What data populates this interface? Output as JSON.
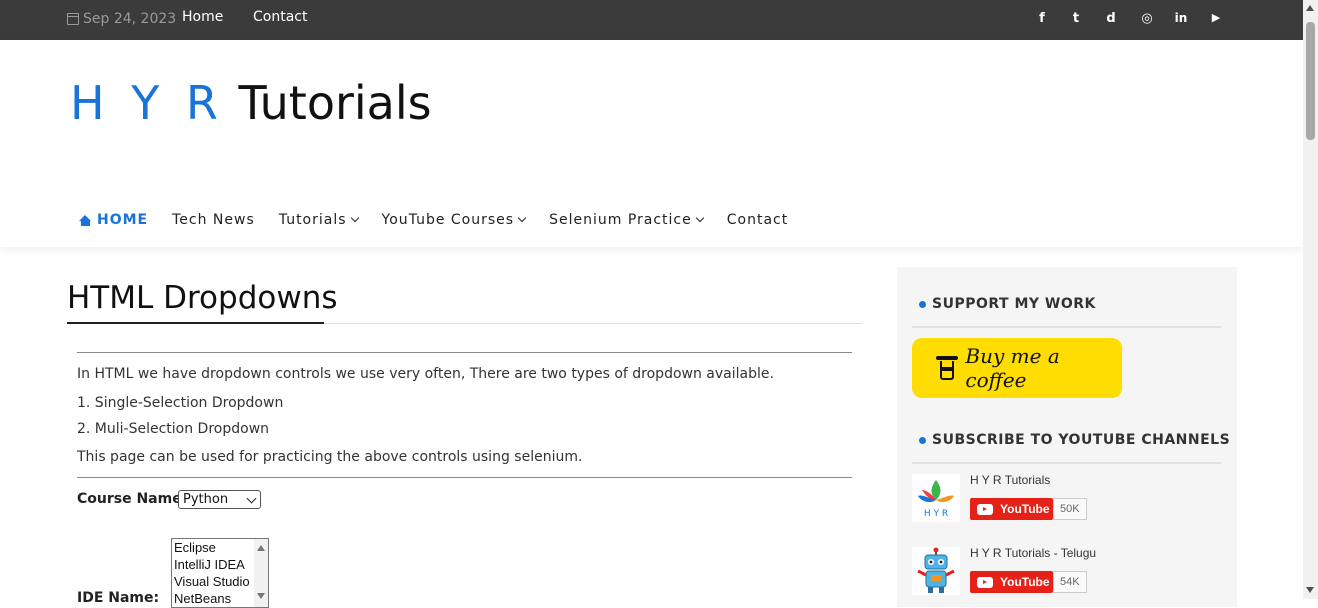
{
  "topbar": {
    "date": "Sep 24, 2023",
    "links": [
      "Home",
      "Contact"
    ],
    "social": [
      {
        "icon": "facebook-icon",
        "glyph": "f"
      },
      {
        "icon": "twitter-icon",
        "glyph": "t"
      },
      {
        "icon": "discord-icon",
        "glyph": "d"
      },
      {
        "icon": "instagram-icon",
        "glyph": "◎"
      },
      {
        "icon": "linkedin-icon",
        "glyph": "in"
      },
      {
        "icon": "youtube-icon",
        "glyph": "▶"
      }
    ]
  },
  "logo": {
    "part1": "H Y R",
    "part2": " Tutorials"
  },
  "nav": {
    "home": "HOME",
    "tech_news": "Tech News",
    "tutorials": "Tutorials",
    "youtube_courses": "YouTube Courses",
    "selenium_practice": "Selenium Practice",
    "contact": "Contact"
  },
  "main": {
    "title": "HTML Dropdowns",
    "intro": "In HTML we have dropdown controls we use very often, There are two types of dropdown available.",
    "item1": "1. Single-Selection Dropdown",
    "item2": "2. Muli-Selection Dropdown",
    "note": "This page can be used for practicing the above controls using selenium.",
    "course_label": "Course Name:",
    "course_value": "Python",
    "ide_label": "IDE Name:",
    "ide_options": [
      "Eclipse",
      "IntelliJ IDEA",
      "Visual Studio",
      "NetBeans"
    ]
  },
  "sidebar": {
    "support_heading": "SUPPORT MY WORK",
    "coffee_label": "Buy me a coffee",
    "subscribe_heading": "SUBSCRIBE TO YOUTUBE CHANNELS",
    "channels": [
      {
        "name": "H Y R Tutorials",
        "button": "YouTube",
        "count": "50K",
        "logo_text": "H Y R"
      },
      {
        "name": "H Y R Tutorials - Telugu",
        "button": "YouTube",
        "count": "54K"
      }
    ]
  },
  "colors": {
    "accent": "#1a73d9",
    "topbar": "#3b3b3b",
    "coffee": "#ffdd00",
    "youtube": "#e62117"
  }
}
